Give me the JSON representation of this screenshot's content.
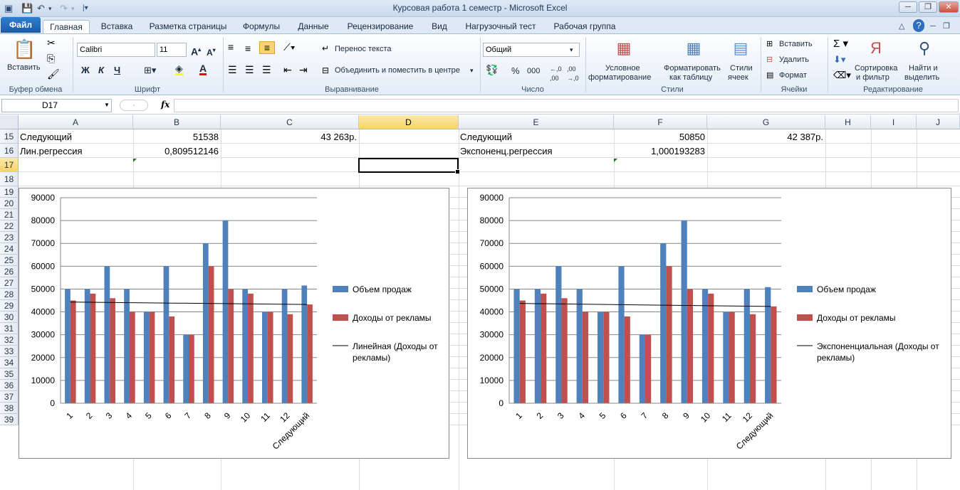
{
  "window": {
    "title": "Курсовая работа 1 семестр  -  Microsoft Excel"
  },
  "tabs": {
    "file": "Файл",
    "items": [
      "Главная",
      "Вставка",
      "Разметка страницы",
      "Формулы",
      "Данные",
      "Рецензирование",
      "Вид",
      "Нагрузочный тест",
      "Рабочая группа"
    ],
    "active": "Главная"
  },
  "ribbon": {
    "paste": "Вставить",
    "clipboard_group": "Буфер обмена",
    "font_name": "Calibri",
    "font_size": "11",
    "font_group": "Шрифт",
    "bold": "Ж",
    "italic": "К",
    "underline": "Ч",
    "wrap_text": "Перенос текста",
    "merge_center": "Объединить и поместить в центре",
    "alignment_group": "Выравнивание",
    "number_format": "Общий",
    "percent": "%",
    "thousands": "000",
    "number_group": "Число",
    "cond_format": "Условное",
    "cond_format2": "форматирование",
    "format_table": "Форматировать",
    "format_table2": "как таблицу",
    "cell_styles": "Стили",
    "cell_styles2": "ячеек",
    "styles_group": "Стили",
    "insert": "Вставить",
    "delete": "Удалить",
    "format": "Формат",
    "cells_group": "Ячейки",
    "sort_filter": "Сортировка",
    "sort_filter2": "и фильтр",
    "find_select": "Найти и",
    "find_select2": "выделить",
    "editing_group": "Редактирование"
  },
  "formula_bar": {
    "name_box": "D17",
    "fx": "fx",
    "formula": ""
  },
  "columns": [
    "A",
    "B",
    "C",
    "D",
    "E",
    "F",
    "G",
    "H",
    "I",
    "J"
  ],
  "selected_column": "D",
  "selected_row": "17",
  "rows": [
    "15",
    "16",
    "17",
    "18",
    "19",
    "20",
    "21",
    "22",
    "23",
    "24",
    "25",
    "26",
    "27",
    "28",
    "29",
    "30",
    "31",
    "32",
    "33",
    "34",
    "35",
    "36",
    "37",
    "38",
    "39"
  ],
  "cells": {
    "A15": "Следующий",
    "B15": "51538",
    "C15": "43 263р.",
    "A16": "Лин.регрессия",
    "B16": "0,809512146",
    "E15": "Следующий",
    "F15": "50850",
    "G15": "42 387р.",
    "E16": "Экспоненц.регрессия",
    "F16": "1,000193283"
  },
  "chart_data": [
    {
      "type": "bar",
      "categories": [
        "1",
        "2",
        "3",
        "4",
        "5",
        "6",
        "7",
        "8",
        "9",
        "10",
        "11",
        "12",
        "Следующий"
      ],
      "series": [
        {
          "name": "Объем продаж",
          "values": [
            50000,
            50000,
            60000,
            50000,
            40000,
            60000,
            30000,
            70000,
            80000,
            50000,
            40000,
            50000,
            51538
          ],
          "color": "#4f81bd"
        },
        {
          "name": "Доходы от рекламы",
          "values": [
            45000,
            48000,
            46000,
            40000,
            40000,
            38000,
            30000,
            60000,
            50000,
            48000,
            40000,
            39000,
            43263
          ],
          "color": "#c0504d"
        }
      ],
      "trendline": {
        "name": "Линейная (Доходы от рекламы)",
        "legend_lines": [
          "Линейная (Доходы от",
          "рекламы)"
        ],
        "start": 44300,
        "end": 43263,
        "color": "#000000"
      },
      "yticks": [
        "90000",
        "80000",
        "70000",
        "60000",
        "50000",
        "40000",
        "30000",
        "20000",
        "10000",
        "0"
      ],
      "ylim": [
        0,
        90000
      ],
      "grid": true,
      "legend": "right"
    },
    {
      "type": "bar",
      "categories": [
        "1",
        "2",
        "3",
        "4",
        "5",
        "6",
        "7",
        "8",
        "9",
        "10",
        "11",
        "12",
        "Следующий"
      ],
      "series": [
        {
          "name": "Объем продаж",
          "values": [
            50000,
            50000,
            60000,
            50000,
            40000,
            60000,
            30000,
            70000,
            80000,
            50000,
            40000,
            50000,
            50850
          ],
          "color": "#4f81bd"
        },
        {
          "name": "Доходы от рекламы",
          "values": [
            45000,
            48000,
            46000,
            40000,
            40000,
            38000,
            30000,
            60000,
            50000,
            48000,
            40000,
            39000,
            42387
          ],
          "color": "#c0504d"
        }
      ],
      "trendline": {
        "name": "Экспоненциальная (Доходы от рекламы)",
        "legend_lines": [
          "Экспоненциальная (Доходы от",
          "рекламы)"
        ],
        "start": 43700,
        "end": 42387,
        "color": "#000000"
      },
      "yticks": [
        "90000",
        "80000",
        "70000",
        "60000",
        "50000",
        "40000",
        "30000",
        "20000",
        "10000",
        "0"
      ],
      "ylim": [
        0,
        90000
      ],
      "grid": true,
      "legend": "right"
    }
  ]
}
